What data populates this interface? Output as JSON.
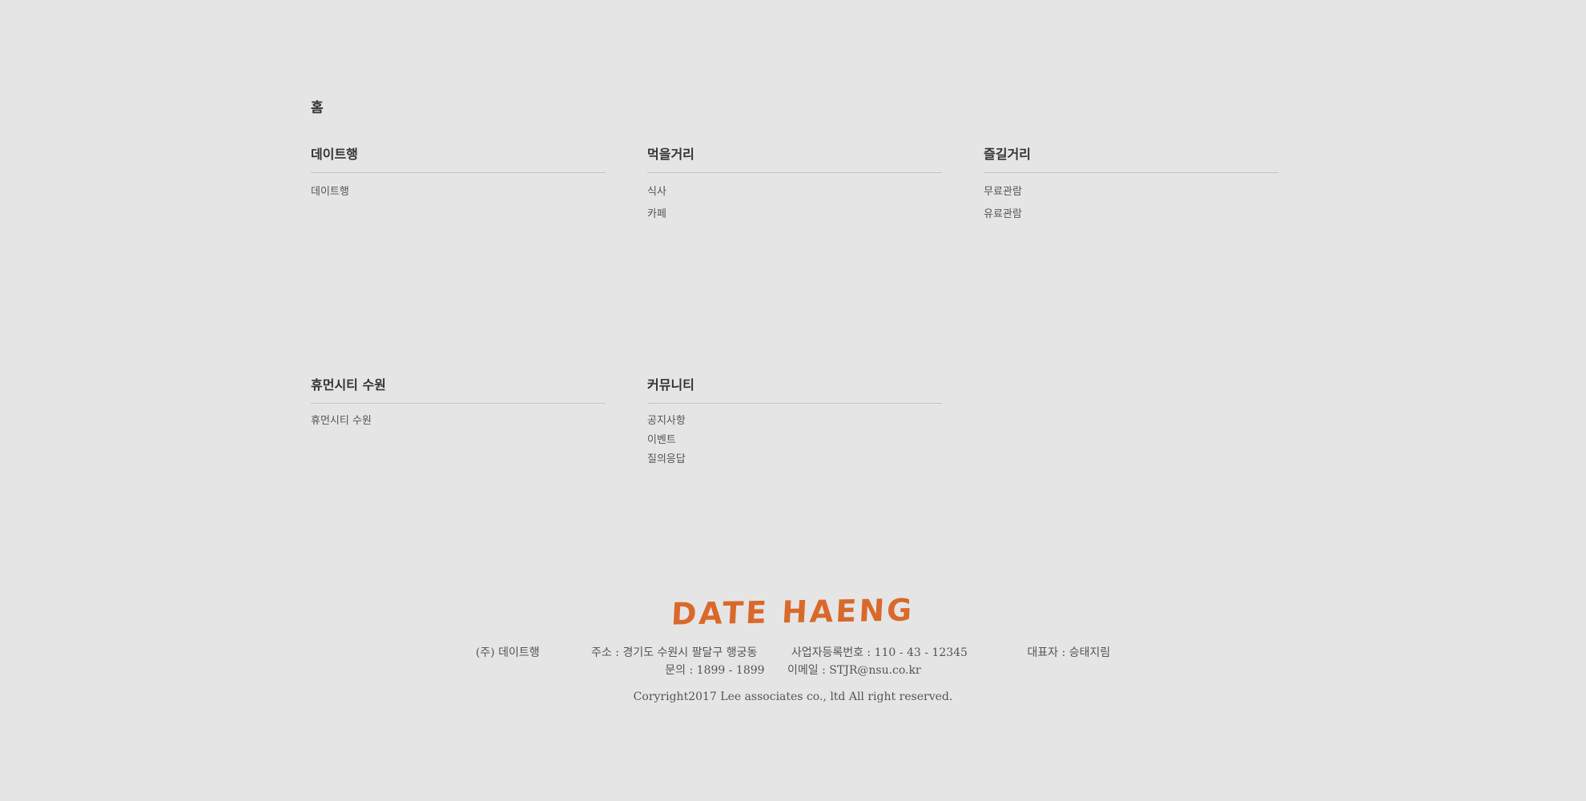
{
  "nav": {
    "home_label": "홈",
    "sections": [
      {
        "title": "데이트행",
        "links": [
          "데이트행"
        ]
      },
      {
        "title": "먹을거리",
        "links": [
          "식사",
          "카페"
        ]
      },
      {
        "title": "즐길거리",
        "links": [
          "무료관람",
          "유료관람"
        ]
      },
      {
        "title": "휴먼시티 수원",
        "links": [
          "휴먼시티 수원"
        ]
      },
      {
        "title": "커뮤니티",
        "links": [
          "공지사항",
          "이벤트",
          "질의응답"
        ]
      }
    ]
  },
  "footer": {
    "logo_text": "DATE HAENG",
    "logo_color": "#d9692b",
    "company": "(주) 데이트행",
    "address": "주소 : 경기도 수원시 팔달구 행궁동",
    "business_number": "사업자등록번호 : 110 - 43 - 12345",
    "representative": "대표자 : 승태지림",
    "contact_phone": "문의 : 1899 - 1899",
    "contact_email": "이메일 : STJR@nsu.co.kr",
    "copyright": "Coryright2017 Lee associates co., ltd All right reserved."
  }
}
